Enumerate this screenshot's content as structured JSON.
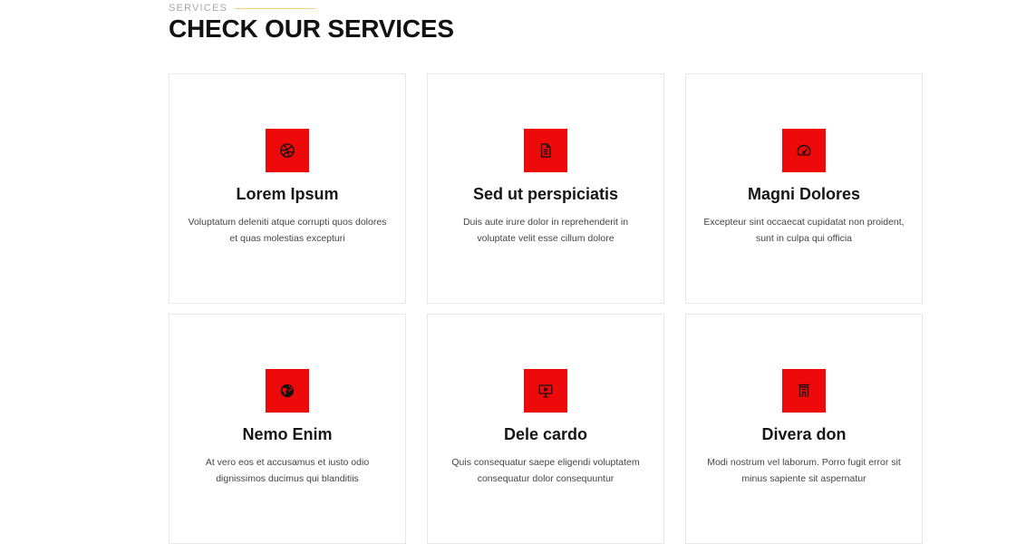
{
  "section": {
    "eyebrow": "SERVICES",
    "title": "CHECK OUR SERVICES"
  },
  "colors": {
    "accent": "#ee0a0a",
    "eyebrow_line": "#f2d27a"
  },
  "services": [
    {
      "icon": "dribbble-icon",
      "title": "Lorem Ipsum",
      "description": "Voluptatum deleniti atque corrupti quos dolores et quas molestias excepturi"
    },
    {
      "icon": "file-text-icon",
      "title": "Sed ut perspiciatis",
      "description": "Duis aute irure dolor in reprehenderit in voluptate velit esse cillum dolore"
    },
    {
      "icon": "speedometer-icon",
      "title": "Magni Dolores",
      "description": "Excepteur sint occaecat cupidatat non proident, sunt in culpa qui officia"
    },
    {
      "icon": "globe-icon",
      "title": "Nemo Enim",
      "description": "At vero eos et accusamus et iusto odio dignissimos ducimus qui blanditiis"
    },
    {
      "icon": "presentation-icon",
      "title": "Dele cardo",
      "description": "Quis consequatur saepe eligendi voluptatem consequatur dolor consequuntur"
    },
    {
      "icon": "building-icon",
      "title": "Divera don",
      "description": "Modi nostrum vel laborum. Porro fugit error sit minus sapiente sit aspernatur"
    }
  ]
}
